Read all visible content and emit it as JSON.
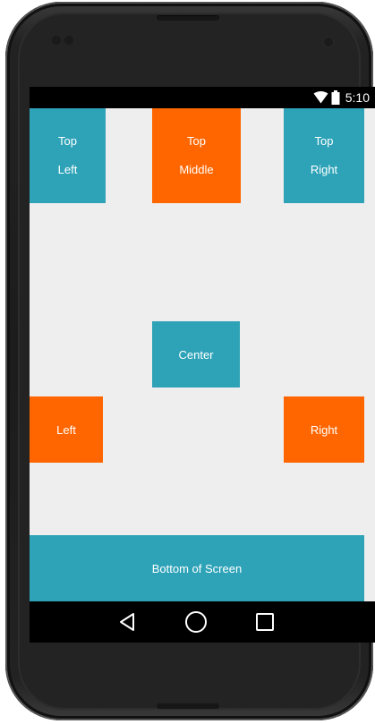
{
  "status_bar": {
    "time": "5:10",
    "icons": [
      "wifi-icon",
      "battery-icon"
    ]
  },
  "layout_boxes": {
    "top_left": {
      "line1": "Top",
      "line2": "Left",
      "color": "#2ea3b8"
    },
    "top_middle": {
      "line1": "Top",
      "line2": "Middle",
      "color": "#ff6600"
    },
    "top_right": {
      "line1": "Top",
      "line2": "Right",
      "color": "#2ea3b8"
    },
    "center": {
      "label": "Center",
      "color": "#2ea3b8"
    },
    "left": {
      "label": "Left",
      "color": "#ff6600"
    },
    "right": {
      "label": "Right",
      "color": "#ff6600"
    },
    "bottom": {
      "label": "Bottom of Screen",
      "color": "#2ea3b8"
    }
  },
  "nav_bar": {
    "buttons": [
      "back-icon",
      "home-icon",
      "recents-icon"
    ]
  },
  "colors": {
    "background": "#eeeeee",
    "teal": "#2ea3b8",
    "orange": "#ff6600"
  }
}
